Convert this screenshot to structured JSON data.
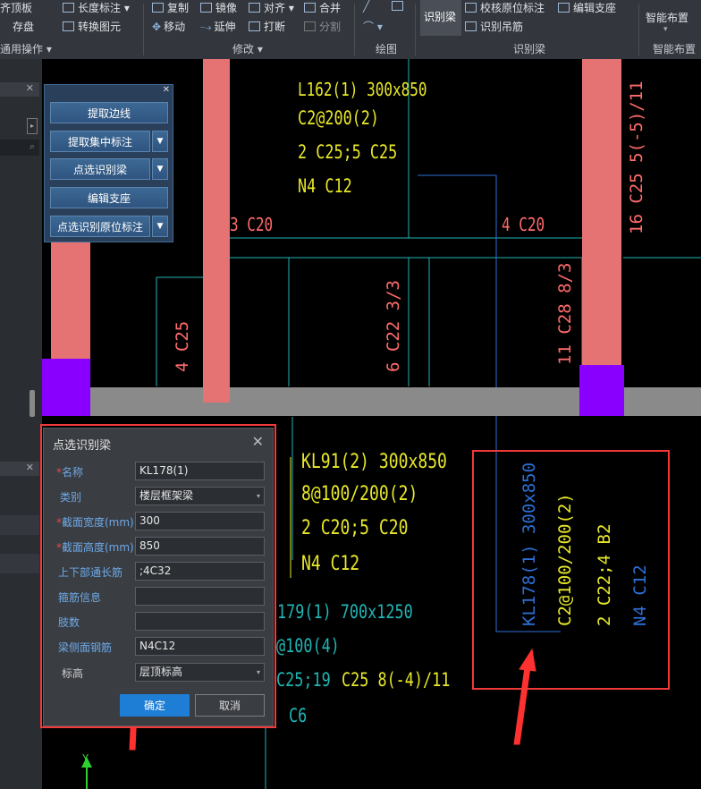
{
  "ribbon": {
    "items": {
      "top_slab": "齐顶板",
      "storage": "存盘",
      "length_mark": "长度标注",
      "convert": "转换图元",
      "copy": "复制",
      "move": "移动",
      "mirror": "镜像",
      "extend": "延伸",
      "align": "对齐",
      "break": "打断",
      "merge": "合并",
      "split": "分割",
      "recognize_beam": "识别梁",
      "check_mark": "校核原位标注",
      "recognize_hanger": "识别吊筋",
      "edit_support": "编辑支座",
      "smart_layout": "智能布置"
    },
    "groups": {
      "common_ops": "通用操作",
      "modify": "修改",
      "draw": "绘图",
      "recognize_beam": "识别梁",
      "smart_layout": "智能布置"
    }
  },
  "beam_panel": {
    "buttons": [
      "提取边线",
      "提取集中标注",
      "点选识别梁",
      "编辑支座",
      "点选识别原位标注"
    ]
  },
  "dialog": {
    "title": "点选识别梁",
    "fields": {
      "name": {
        "label": "名称",
        "value": "KL178(1)"
      },
      "type": {
        "label": "类别",
        "value": "楼层框架梁"
      },
      "width": {
        "label": "截面宽度(mm)",
        "value": "300"
      },
      "height": {
        "label": "截面高度(mm)",
        "value": "850"
      },
      "main_rebar": {
        "label": "上下部通长筋",
        "value": ";4C32"
      },
      "stirrup": {
        "label": "箍筋信息",
        "value": ""
      },
      "legs": {
        "label": "肢数",
        "value": ""
      },
      "side_rebar": {
        "label": "梁侧面钢筋",
        "value": "N4C12"
      },
      "elevation": {
        "label": "标高",
        "value": "层顶标高"
      }
    },
    "ok": "确定",
    "cancel": "取消"
  },
  "cad_text": {
    "top_1": "L162(1) 300x850",
    "top_2": "C2@200(2)",
    "top_3": "2 C25;5  C25",
    "top_4": "N4 C12",
    "left_1": "3 C20",
    "mid_1": "4 C20",
    "vert_a": "4 C25",
    "vert_b": "6 C22 3/3",
    "vert_c": "11 C28 8/3",
    "vert_d": "16 C25 5(-5)/11",
    "kl91_1": "KL91(2) 300x850",
    "kl91_2": "8@100/200(2)",
    "kl91_3": "2 C20;5  C20",
    "kl91_4": "N4 C12",
    "low_1": "179(1) 700x1250",
    "low_2": "@100(4)",
    "low_3": "C25;19",
    "low_4": "C25 8(-4)/11",
    "low_5": "C6",
    "kl178_1": "KL178(1) 300x850",
    "kl178_2": "C2@100/200(2)",
    "kl178_3": "2 C22;4  B2",
    "kl178_4": "N4 C12",
    "axis_y": "Y"
  }
}
